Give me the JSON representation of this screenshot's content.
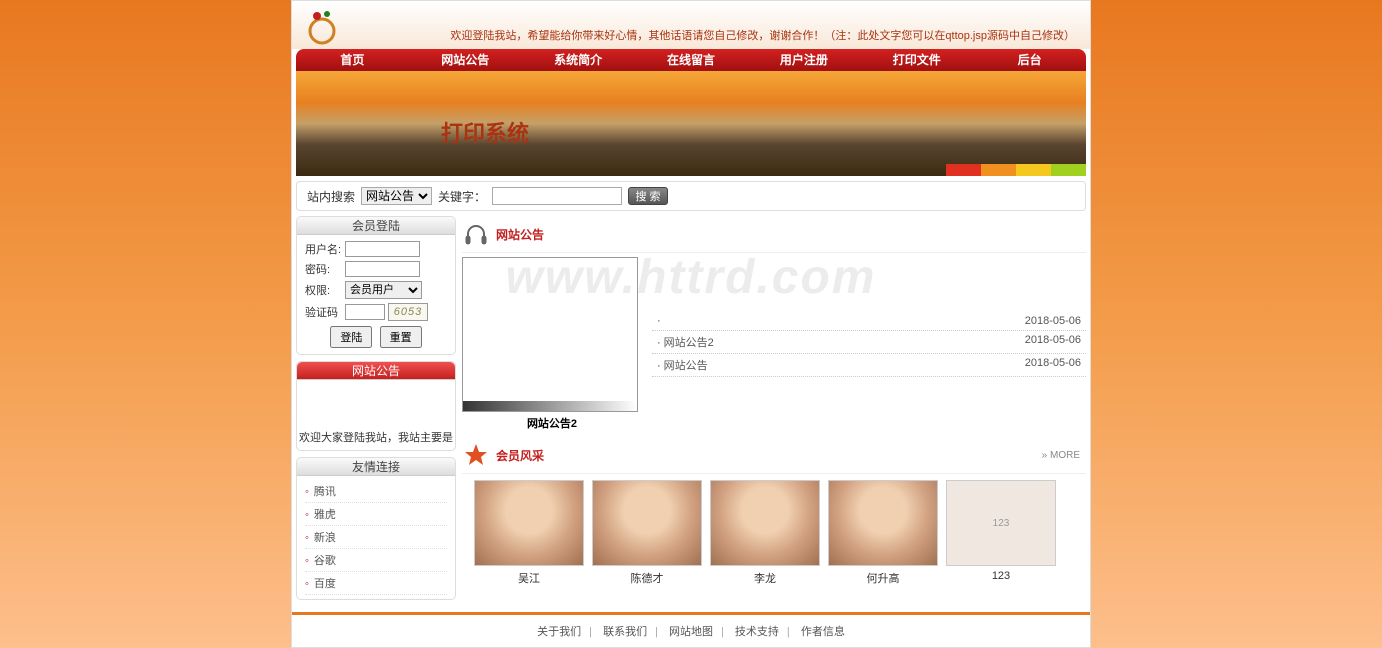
{
  "header": {
    "welcome_text": "欢迎登陆我站，希望能给你带来好心情，其他话语请您自己修改，谢谢合作！（注：此处文字您可以在qttop.jsp源码中自己修改）"
  },
  "nav": [
    "首页",
    "网站公告",
    "系统简介",
    "在线留言",
    "用户注册",
    "打印文件",
    "后台"
  ],
  "banner": {
    "title": "打印系统"
  },
  "search": {
    "label": "站内搜索",
    "select_value": "网站公告",
    "keyword_label": "关键字：",
    "button": "搜 索"
  },
  "login": {
    "header": "会员登陆",
    "username_label": "用户名:",
    "password_label": "密码:",
    "role_label": "权限:",
    "role_value": "会员用户",
    "captcha_label": "验证码",
    "captcha_value": "6053",
    "submit": "登陆",
    "reset": "重置"
  },
  "announce_widget": {
    "header": "网站公告",
    "scroll_text": "欢迎大家登陆我站，我站主要是"
  },
  "links": {
    "header": "友情连接",
    "items": [
      "腾讯",
      "雅虎",
      "新浪",
      "谷歌",
      "百度"
    ]
  },
  "announcements": {
    "title": "网站公告",
    "featured_caption": "网站公告2",
    "items": [
      {
        "title": "",
        "date": "2018-05-06"
      },
      {
        "title": "网站公告2",
        "date": "2018-05-06"
      },
      {
        "title": "网站公告",
        "date": "2018-05-06"
      }
    ]
  },
  "members": {
    "title": "会员风采",
    "more": "» MORE",
    "items": [
      {
        "name": "吴江"
      },
      {
        "name": "陈德才"
      },
      {
        "name": "李龙"
      },
      {
        "name": "何升高"
      },
      {
        "name": "123"
      }
    ]
  },
  "footer": {
    "items": [
      "关于我们",
      "联系我们",
      "网站地图",
      "技术支持",
      "作者信息"
    ]
  },
  "watermark": "www.httrd.com"
}
